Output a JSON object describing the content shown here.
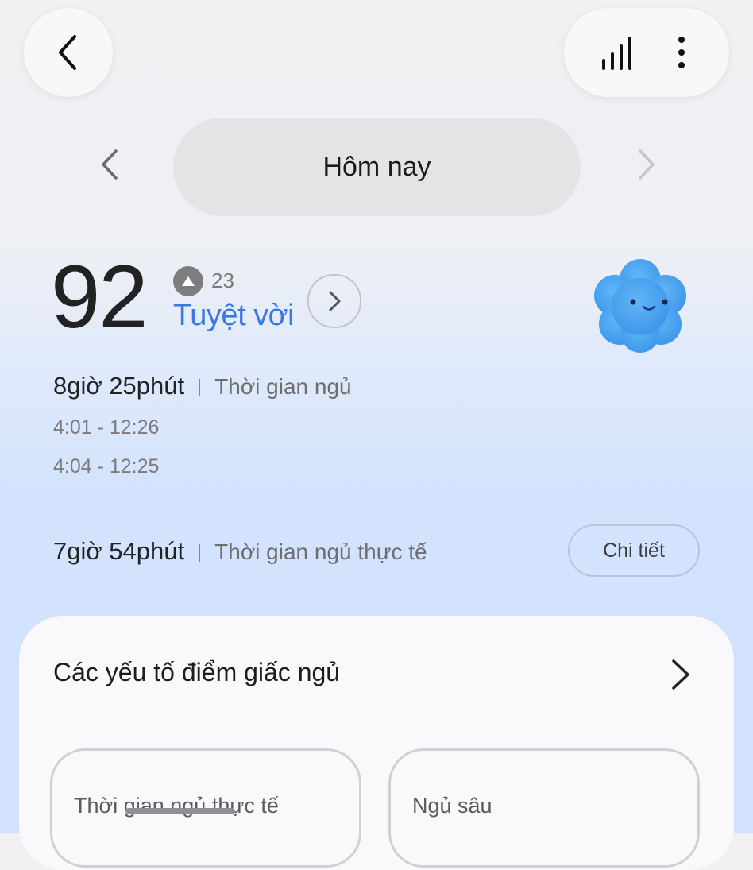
{
  "header": {
    "back_icon": "chevron-left-icon",
    "stats_icon": "bar-chart-icon",
    "more_icon": "more-vertical-icon"
  },
  "date_nav": {
    "label": "Hôm nay",
    "prev_icon": "chevron-left-icon",
    "next_icon": "chevron-right-icon"
  },
  "score": {
    "value": "92",
    "delta": "23",
    "rating": "Tuyệt vời",
    "mascot_icon": "cloud-mascot-icon"
  },
  "sleep": {
    "duration": "8giờ 25phút",
    "duration_label": "Thời gian ngủ",
    "range_1": "4:01 - 12:26",
    "range_2": "4:04 - 12:25",
    "actual_duration": "7giờ 54phút",
    "actual_label": "Thời gian ngủ thực tế",
    "details_button": "Chi tiết"
  },
  "factors": {
    "title": "Các yếu tố điểm giấc ngủ",
    "items": [
      {
        "label": "Thời gian ngủ thực tế"
      },
      {
        "label": "Ngủ sâu"
      }
    ]
  },
  "colors": {
    "accent": "#3a79e2",
    "mascot": "#4aa3f0"
  }
}
